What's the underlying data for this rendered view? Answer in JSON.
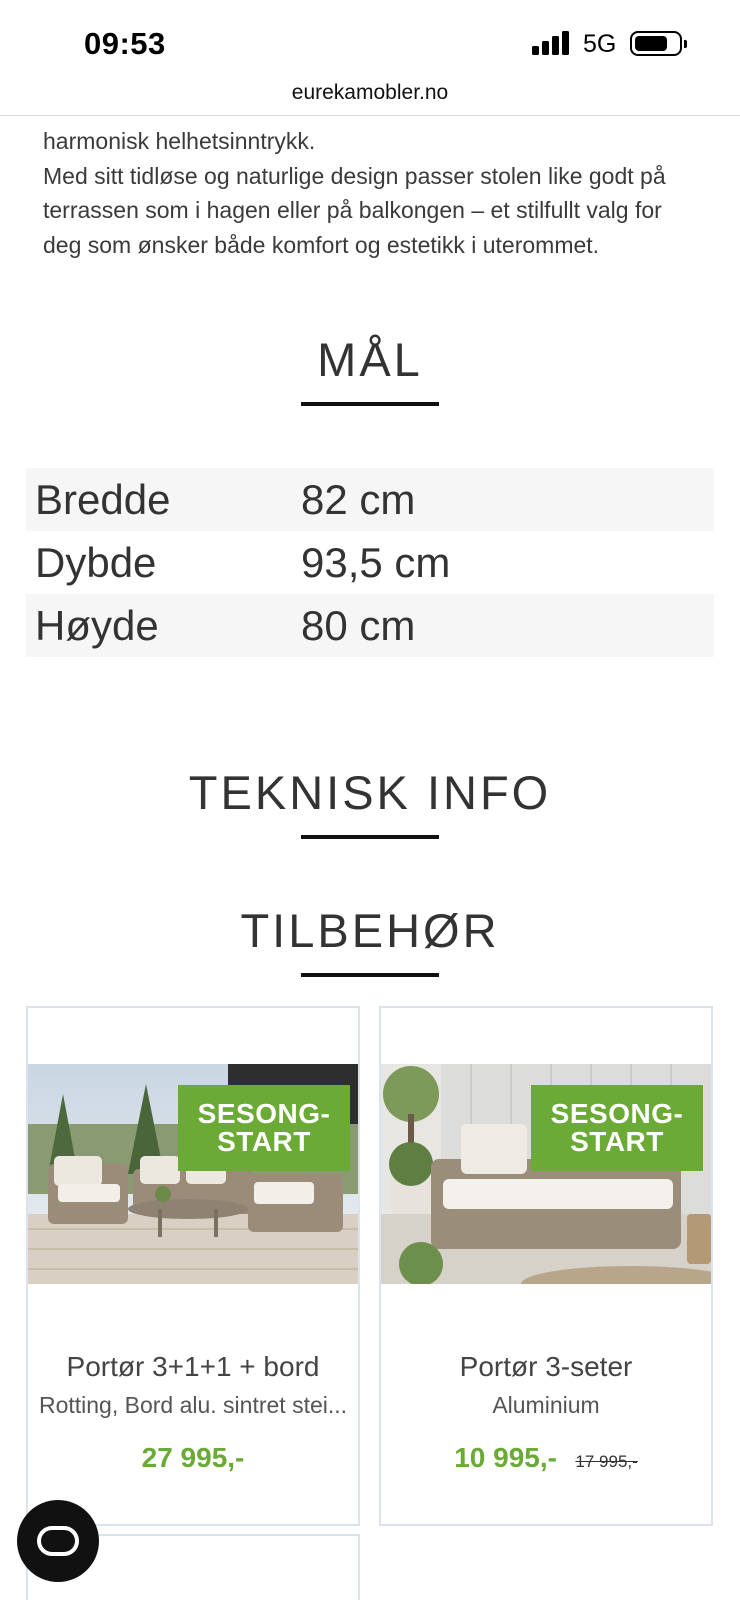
{
  "status_bar": {
    "time": "09:53",
    "network": "5G"
  },
  "browser": {
    "url": "eurekamobler.no"
  },
  "description": {
    "line1": "harmonisk helhetsinntrykk.",
    "paragraph": "Med sitt tidløse og naturlige design passer stolen like godt på terrassen som i hagen eller på balkongen – et stilfullt valg for deg som ønsker både komfort og estetikk i uterommet."
  },
  "dimensions": {
    "title": "MÅL",
    "rows": [
      {
        "label": "Bredde",
        "value": "82 cm"
      },
      {
        "label": "Dybde",
        "value": "93,5 cm"
      },
      {
        "label": "Høyde",
        "value": "80 cm"
      }
    ]
  },
  "technical": {
    "title": "TEKNISK INFO"
  },
  "accessories": {
    "title": "TILBEHØR",
    "products": [
      {
        "badge_line1": "SESONG-",
        "badge_line2": "START",
        "name": "Portør 3+1+1 + bord",
        "subtitle": "Rotting, Bord alu. sintret stei...",
        "price": "27 995,-",
        "old_price": ""
      },
      {
        "badge_line1": "SESONG-",
        "badge_line2": "START",
        "name": "Portør 3-seter",
        "subtitle": "Aluminium",
        "price": "10 995,-",
        "old_price": "17 995,-"
      }
    ]
  },
  "colors": {
    "accent_green": "#6aaa35",
    "card_border": "#dde3ee",
    "text": "#333333"
  },
  "icons": {
    "chat": "chat-bubble-icon"
  }
}
